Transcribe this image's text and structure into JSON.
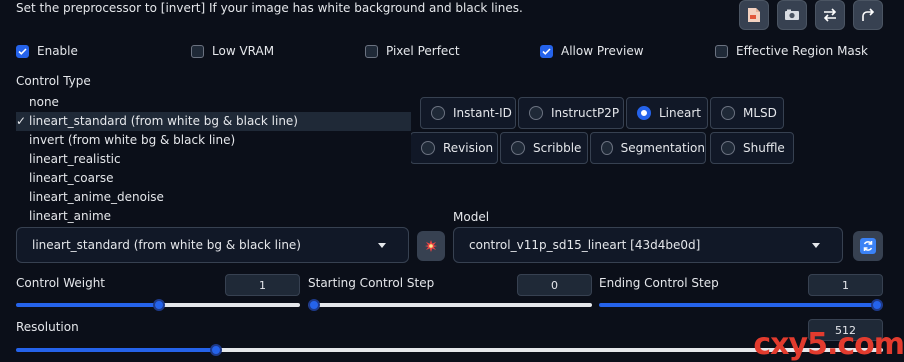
{
  "hint": "Set the preprocessor to [invert] If your image has white background and black lines.",
  "toolbar": [
    "file-icon",
    "camera-icon",
    "swap-icon",
    "send-icon"
  ],
  "checkboxes": [
    {
      "label": "Enable",
      "checked": true
    },
    {
      "label": "Low VRAM",
      "checked": false
    },
    {
      "label": "Pixel Perfect",
      "checked": false
    },
    {
      "label": "Allow Preview",
      "checked": true
    },
    {
      "label": "Effective Region Mask",
      "checked": false
    }
  ],
  "control_type": {
    "label": "Control Type",
    "row1": [
      {
        "label": "Instant-ID",
        "selected": false
      },
      {
        "label": "InstructP2P",
        "selected": false
      },
      {
        "label": "Lineart",
        "selected": true
      },
      {
        "label": "MLSD",
        "selected": false
      }
    ],
    "row2": [
      {
        "label": "Revision",
        "selected": false
      },
      {
        "label": "Scribble",
        "selected": false
      },
      {
        "label": "Segmentation",
        "selected": false
      },
      {
        "label": "Shuffle",
        "selected": false
      }
    ]
  },
  "preprocessor_dropdown": {
    "options": [
      "none",
      "lineart_standard (from white bg & black line)",
      "invert (from white bg & black line)",
      "lineart_realistic",
      "lineart_coarse",
      "lineart_anime_denoise",
      "lineart_anime"
    ],
    "selected_index": 1,
    "check_mark": "✓",
    "value": "lineart_standard (from white bg & black line)"
  },
  "model": {
    "label": "Model",
    "value": "control_v11p_sd15_lineart [43d4be0d]"
  },
  "control_weight": {
    "label": "Control Weight",
    "value": "1",
    "fraction": 0.48
  },
  "starting_step": {
    "label": "Starting Control Step",
    "value": "0",
    "fraction": 0.0
  },
  "ending_step": {
    "label": "Ending Control Step",
    "value": "1",
    "fraction": 1.0
  },
  "resolution": {
    "label": "Resolution",
    "value": "512",
    "fraction": 0.23
  },
  "watermark": "cxy5.com",
  "colors": {
    "accent": "#2563eb",
    "background": "#0b0f19",
    "watermark": "#e23b2e"
  }
}
